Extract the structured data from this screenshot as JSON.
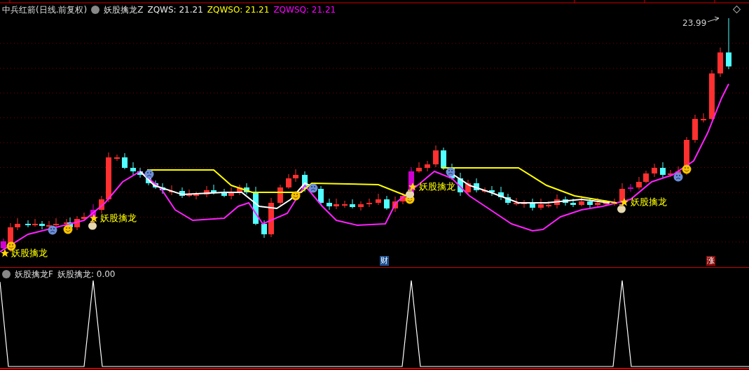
{
  "header": {
    "title": "中兵红箭(日线.前复权)",
    "indicator": "妖股擒龙Z",
    "readings": [
      {
        "text": "ZQWS: 21.21",
        "color": "#e6e6e6"
      },
      {
        "text": "ZQWSO: 21.21",
        "color": "#ffff00"
      },
      {
        "text": "ZQWSQ: 21.21",
        "color": "#ff00ff"
      }
    ]
  },
  "price_chart": {
    "max_label": "23.99",
    "signals": [
      {
        "label": "妖股擒龙"
      },
      {
        "label": "妖股擒龙"
      },
      {
        "label": "妖股擒龙"
      },
      {
        "label": "妖股擒龙"
      }
    ],
    "markers": [
      {
        "text": "财",
        "color": "#1c4f8f"
      },
      {
        "text": "涨",
        "color": "#8b0a0a"
      }
    ]
  },
  "sub_panel": {
    "indicator": "妖股擒龙F",
    "reading": "妖股擒龙: 0.00"
  }
}
